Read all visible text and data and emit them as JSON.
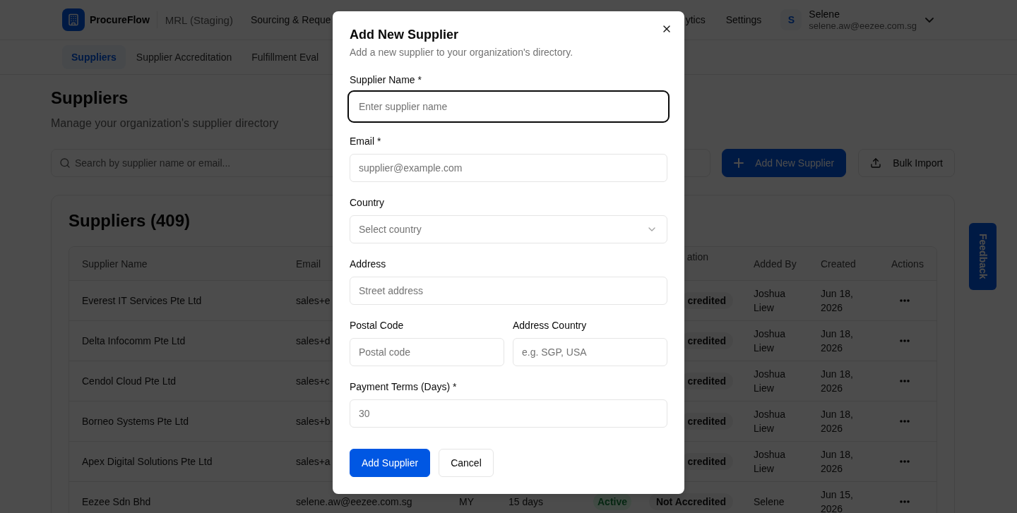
{
  "top_nav": {
    "app_name": "ProcureFlow",
    "environment": "MRL (Staging)",
    "links": [
      {
        "label": "Sourcing & Reque"
      },
      {
        "label": "ytics"
      },
      {
        "label": "Settings"
      }
    ],
    "user": {
      "initial": "S",
      "name": "Selene",
      "email": "selene.aw@eezee.com.sg"
    }
  },
  "sub_nav": {
    "tabs": [
      {
        "label": "Suppliers",
        "selected": true
      },
      {
        "label": "Supplier Accreditation",
        "selected": false
      },
      {
        "label": "Fulfillment Eval",
        "selected": false
      }
    ]
  },
  "page_header": {
    "title": "Suppliers",
    "subtitle": "Manage your organization's supplier directory"
  },
  "toolbar": {
    "search": {
      "placeholder": "Search by supplier name or email..."
    },
    "buttons": [
      {
        "kind": "primary",
        "label": "Add New Supplier"
      },
      {
        "kind": "secondary",
        "label": "Bulk Import"
      }
    ]
  },
  "suppliers_card": {
    "title": "Suppliers (409)",
    "table": {
      "columns": {
        "supplier_name": "Supplier Name",
        "email": "Email",
        "column_6": "ation",
        "added_by": "Added By",
        "created": "Created",
        "actions": "Actions"
      },
      "rows": [
        {
          "supplier_name": "Everest IT Services Pte Ltd",
          "email": "sales+e",
          "column_6": "credited",
          "added_by": "Joshua Liew",
          "created": "Jun 18, 2026"
        },
        {
          "supplier_name": "Delta Infocomm Pte Ltd",
          "email": "sales+d",
          "column_6": "credited",
          "added_by": "Joshua Liew",
          "created": "Jun 18, 2026"
        },
        {
          "supplier_name": "Cendol Cloud Pte Ltd",
          "email": "sales+c",
          "column_6": "credited",
          "added_by": "Joshua Liew",
          "created": "Jun 18, 2026"
        },
        {
          "supplier_name": "Borneo Systems Pte Ltd",
          "email": "sales+b",
          "column_6": "credited",
          "added_by": "Joshua Liew",
          "created": "Jun 18, 2026"
        },
        {
          "supplier_name": "Apex Digital Solutions Pte Ltd",
          "email": "sales+a",
          "column_6": "credited",
          "added_by": "Joshua Liew",
          "created": "Jun 18, 2026"
        },
        {
          "supplier_name": "Eezee Sdn Bhd",
          "email": "selene.aw@eezee.com.sg",
          "column_3": "MY",
          "column_4": "15 days",
          "column_5": "Active",
          "column_6": "Not Accredited",
          "added_by": "Selene",
          "created": "Jun 15, 2026"
        }
      ]
    }
  },
  "feedback_tab": {
    "label": "Feedback"
  },
  "dialog": {
    "title": "Add New Supplier",
    "description": "Add a new supplier to your organization's directory.",
    "field_rows": [
      {
        "fields": [
          {
            "kind": "text",
            "label": "Supplier Name *",
            "placeholder": "Enter supplier name",
            "focused": true
          }
        ]
      },
      {
        "fields": [
          {
            "kind": "text",
            "label": "Email *",
            "placeholder": "supplier@example.com",
            "focused": false
          }
        ]
      },
      {
        "fields": [
          {
            "kind": "select",
            "label": "Country",
            "placeholder": "Select country",
            "focused": false
          }
        ]
      },
      {
        "fields": [
          {
            "kind": "text",
            "label": "Address",
            "placeholder": "Street address",
            "focused": false
          }
        ]
      },
      {
        "fields": [
          {
            "kind": "text",
            "label": "Postal Code",
            "placeholder": "Postal code",
            "focused": false
          },
          {
            "kind": "text",
            "label": "Address Country",
            "placeholder": "e.g. SGP, USA",
            "focused": false
          }
        ]
      },
      {
        "fields": [
          {
            "kind": "text",
            "label": "Payment Terms (Days) *",
            "placeholder": "30",
            "focused": false
          }
        ]
      }
    ],
    "actions": [
      {
        "kind": "primary",
        "label": "Add Supplier"
      },
      {
        "kind": "secondary",
        "label": "Cancel"
      }
    ]
  }
}
